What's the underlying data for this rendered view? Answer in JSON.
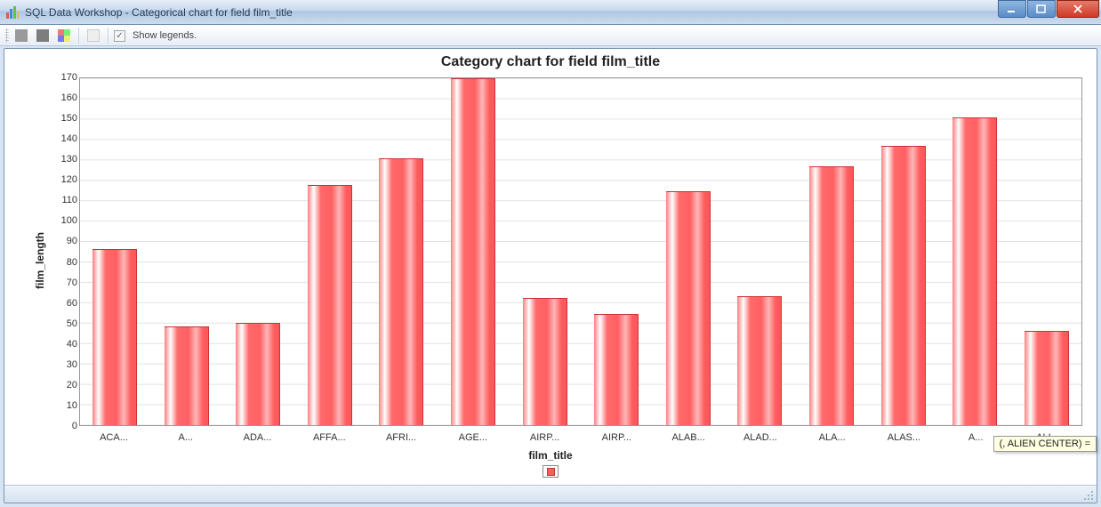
{
  "window": {
    "title": "SQL Data Workshop - Categorical chart for field film_title"
  },
  "toolbar": {
    "show_legends_label": "Show legends.",
    "show_legends_checked": true
  },
  "chart_data": {
    "type": "bar",
    "title": "Category chart for field film_title",
    "xlabel": "film_title",
    "ylabel": "film_length",
    "ylim": [
      0,
      170
    ],
    "yticks": [
      0,
      10,
      20,
      30,
      40,
      50,
      60,
      70,
      80,
      90,
      100,
      110,
      120,
      130,
      140,
      150,
      160,
      170
    ],
    "categories": [
      "ACA...",
      "A...",
      "ADA...",
      "AFFA...",
      "AFRI...",
      "AGE...",
      "AIRP...",
      "AIRP...",
      "ALAB...",
      "ALAD...",
      "ALA...",
      "ALAS...",
      "A...",
      "ALI..."
    ],
    "values": [
      86,
      48,
      50,
      117,
      130,
      169,
      62,
      54,
      114,
      63,
      126,
      136,
      150,
      46
    ]
  },
  "tooltip": "(, ALIEN CENTER) ="
}
